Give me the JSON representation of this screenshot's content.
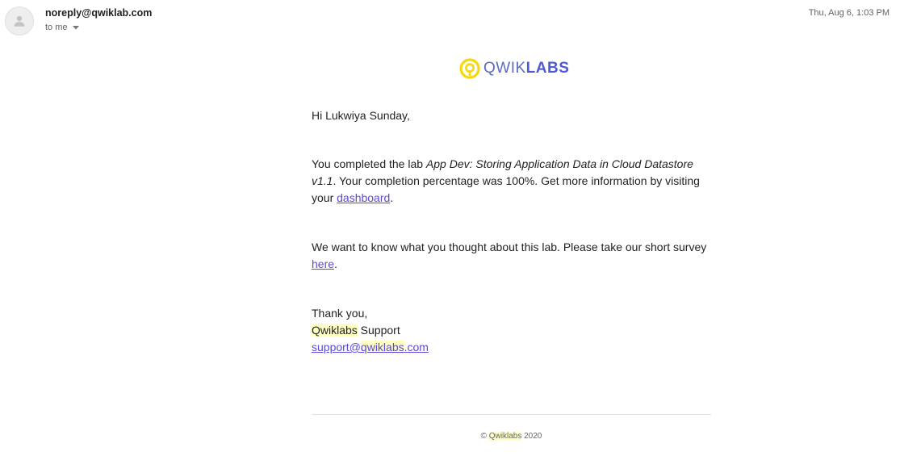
{
  "header": {
    "sender": "noreply@qwiklab.com",
    "recipient": "to me",
    "date": "Thu, Aug 6, 1:03 PM"
  },
  "logo": {
    "qwik": "QWIK",
    "labs": "LABS"
  },
  "message": {
    "greeting": "Hi Lukwiya Sunday,",
    "completed_prefix": "You completed the lab ",
    "lab_name": "App Dev: Storing Application Data in Cloud Datastore v1.1",
    "completed_suffix": ". Your completion percentage was 100%. Get more information by visiting your ",
    "dashboard_link": "dashboard",
    "period1": ".",
    "survey_prefix": "We want to know what you thought about this lab. Please take our short survey ",
    "survey_link": "here",
    "period2": ".",
    "thanks": "Thank you,",
    "signature_brand": "Qwiklabs",
    "signature_suffix": " Support",
    "support_email_user": "support@",
    "support_email_brand": "qwiklabs",
    "support_email_tld": ".com"
  },
  "footer": {
    "copyright_symbol": "©",
    "brand": "Qwiklabs",
    "year": "2020"
  },
  "colors": {
    "link": "#5b4ad8",
    "highlight": "#fdfdc4",
    "logo_yellow": "#f5d90a",
    "logo_blue": "#4c5bd4"
  }
}
